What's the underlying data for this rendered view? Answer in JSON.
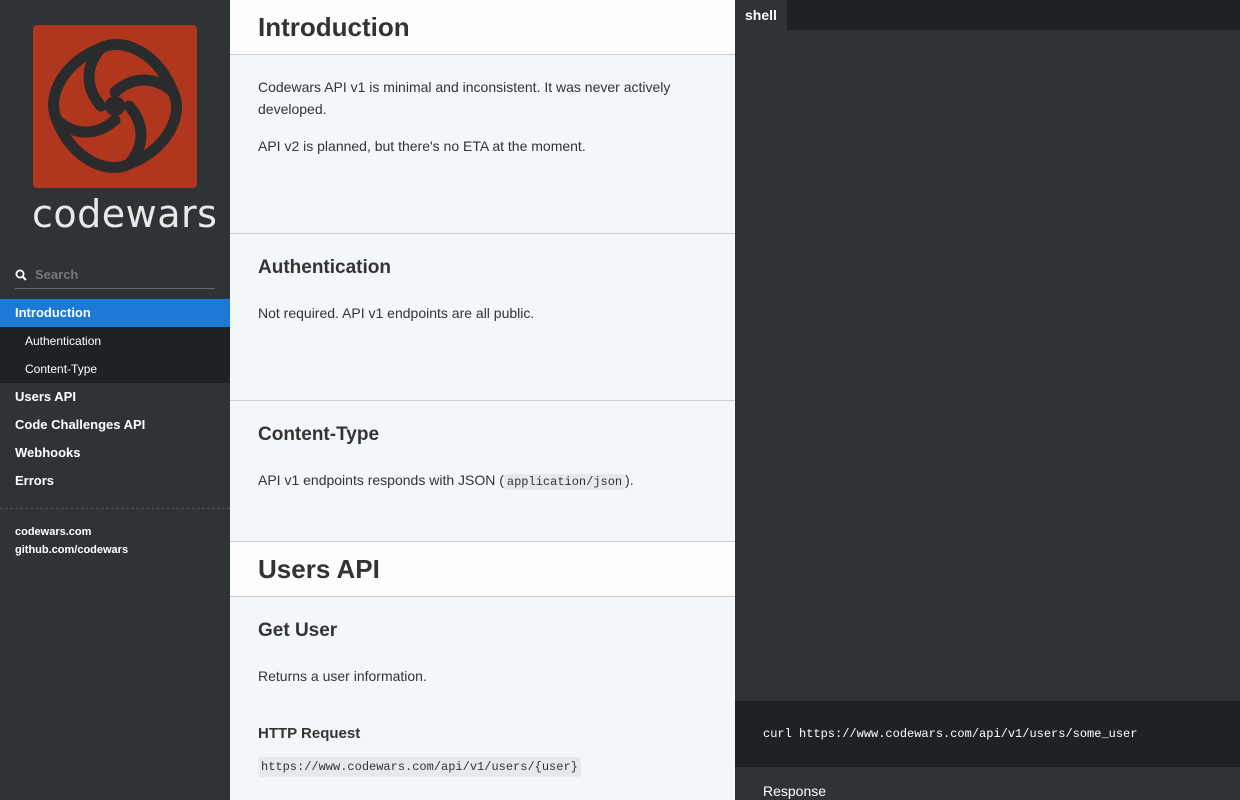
{
  "sidebar": {
    "logo_text": "codewars",
    "search_placeholder": "Search",
    "toc": {
      "introduction": "Introduction",
      "authentication": "Authentication",
      "content_type": "Content-Type",
      "users_api": "Users API",
      "code_challenges_api": "Code Challenges API",
      "webhooks": "Webhooks",
      "errors": "Errors"
    },
    "footer_links": [
      "codewars.com",
      "github.com/codewars"
    ]
  },
  "content": {
    "intro_title": "Introduction",
    "intro_p1": "Codewars API v1 is minimal and inconsistent. It was never actively developed.",
    "intro_p2": "API v2 is planned, but there's no ETA at the moment.",
    "auth_title": "Authentication",
    "auth_p": "Not required. API v1 endpoints are all public.",
    "ct_title": "Content-Type",
    "ct_p_before": "API v1 endpoints responds with JSON (",
    "ct_code": "application/json",
    "ct_p_after": ").",
    "users_title": "Users API",
    "get_user_title": "Get User",
    "get_user_p": "Returns a user information.",
    "http_request_title": "HTTP Request",
    "http_request_url": "https://www.codewars.com/api/v1/users/{user}"
  },
  "code_panel": {
    "language_tab": "shell",
    "curl_command": "curl https://www.codewars.com/api/v1/users/some_user",
    "response_label": "Response"
  },
  "colors": {
    "sidebar_bg": "#2e3336",
    "active_item": "#1b79d8",
    "logo_red": "#b1361e"
  }
}
